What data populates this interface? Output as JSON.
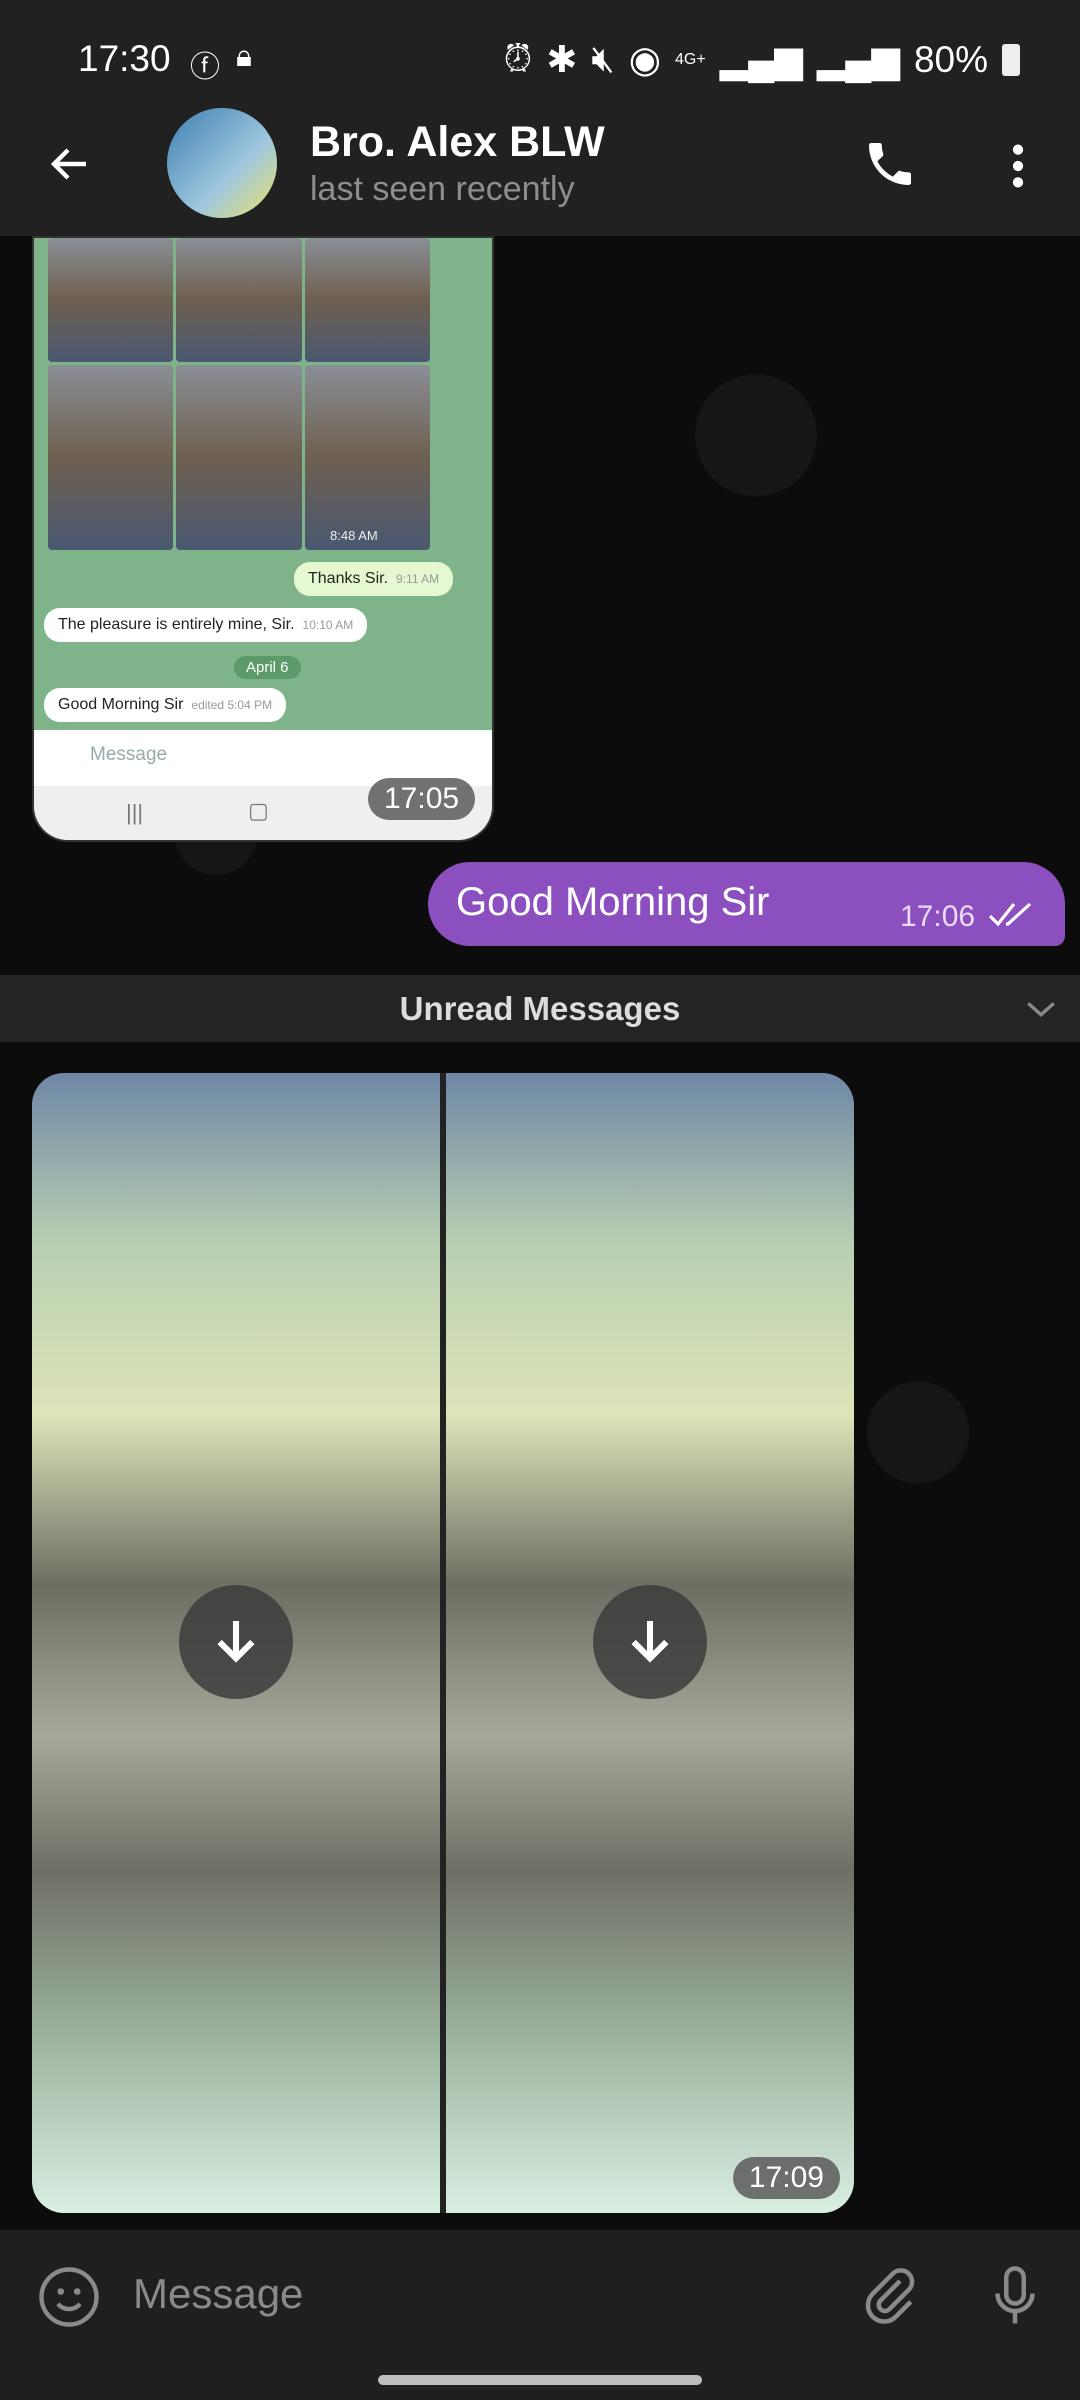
{
  "status_bar": {
    "time": "17:30",
    "battery": "80%",
    "network": "4G+",
    "icons": [
      "facebook-icon",
      "lock-icon",
      "alarm-icon",
      "bluetooth-icon",
      "mute-icon",
      "hotspot-icon",
      "signal-icon",
      "signal-icon",
      "battery-icon"
    ]
  },
  "header": {
    "title": "Bro. Alex BLW",
    "subtitle": "last seen recently"
  },
  "screenshot_message": {
    "time": "17:05",
    "inner": {
      "photo_time": "8:48 AM",
      "msg1": "Thanks Sir.",
      "msg1_time": "9:11 AM",
      "msg2": "The pleasure is entirely mine, Sir.",
      "msg2_time": "10:10 AM",
      "date": "April 6",
      "msg3": "Good Morning Sir",
      "msg3_time": "edited 5:04 PM",
      "input_placeholder": "Message"
    }
  },
  "outgoing": {
    "text": "Good Morning Sir",
    "time": "17:06"
  },
  "unread": {
    "label": "Unread Messages"
  },
  "album": {
    "time": "17:09"
  },
  "input": {
    "placeholder": "Message"
  },
  "colors": {
    "outgoing_bubble": "#8b4fc0",
    "header": "#212121"
  }
}
